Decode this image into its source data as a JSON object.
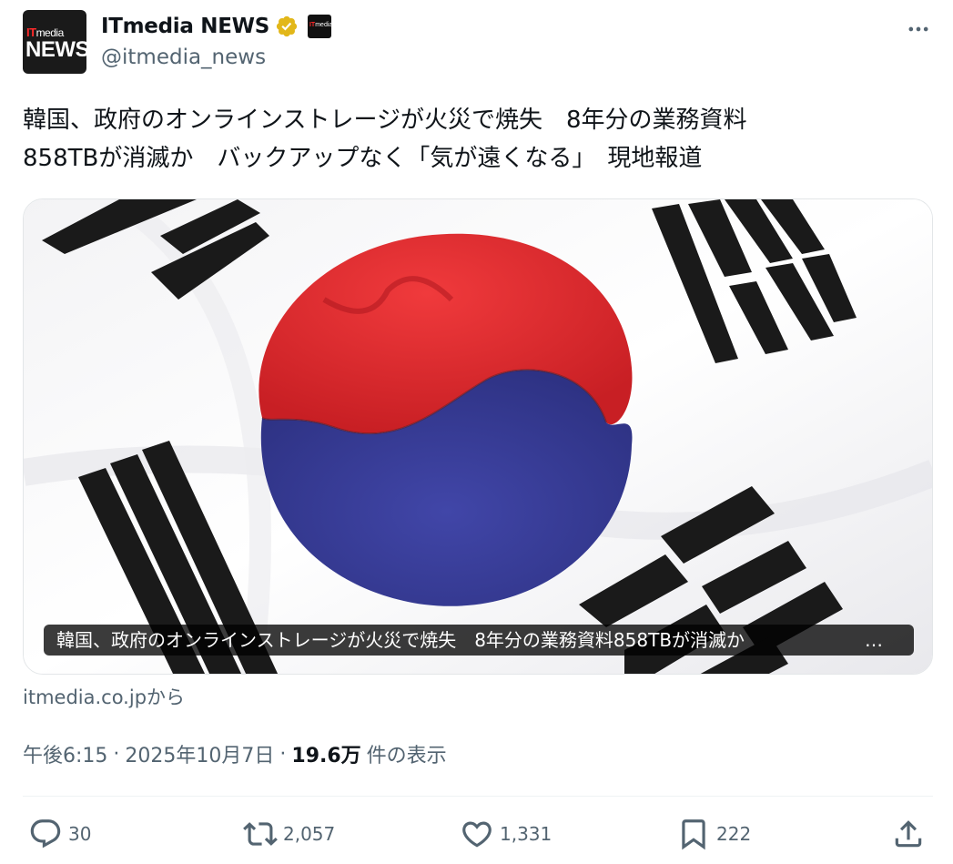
{
  "tweet": {
    "avatar": {
      "logo_top_it": "IT",
      "logo_top_media": "media",
      "logo_bottom": "NEWS"
    },
    "display_name": "ITmedia NEWS",
    "handle": "@itmedia_news",
    "text": "韓国、政府のオンラインストレージが火災で焼失　8年分の業務資料\n858TBが消滅か　バックアップなく「気が遠くなる」　現地報道",
    "card": {
      "caption": "韓国、政府のオンラインストレージが火災で焼失　8年分の業務資料858TBが消滅か",
      "caption_ellipsis": "…",
      "source": "itmedia.co.jpから"
    },
    "time": "午後6:15",
    "date": "2025年10月7日",
    "separator": "·",
    "views_count": "19.6万",
    "views_label": "件の表示",
    "affiliation_badge": {
      "it": "IT",
      "media": "media"
    }
  },
  "actions": {
    "reply": {
      "count": "30",
      "icon": "reply-icon"
    },
    "retweet": {
      "count": "2,057",
      "icon": "retweet-icon"
    },
    "like": {
      "count": "1,331",
      "icon": "like-icon"
    },
    "bookmark": {
      "count": "222",
      "icon": "bookmark-icon"
    },
    "share": {
      "icon": "share-icon"
    }
  },
  "colors": {
    "text": "#0f1419",
    "secondary": "#536471",
    "verified_gold": "#e2b719",
    "flag_red": "#e8292d",
    "flag_blue": "#3a3f9a"
  }
}
